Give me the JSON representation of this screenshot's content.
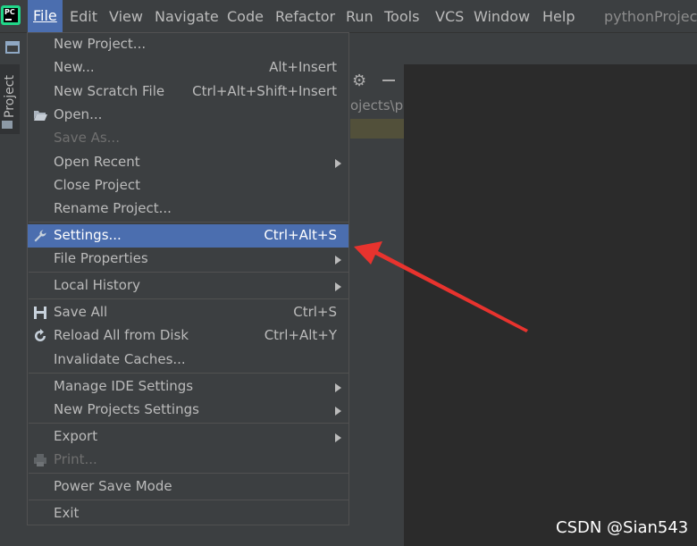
{
  "app": {
    "logo_text": "PC",
    "project_title": "pythonProject"
  },
  "menubar": {
    "items": [
      {
        "label": "File",
        "underline": "F"
      },
      {
        "label": "Edit",
        "underline": "E"
      },
      {
        "label": "View",
        "underline": "V"
      },
      {
        "label": "Navigate",
        "underline": "N"
      },
      {
        "label": "Code",
        "underline": "C"
      },
      {
        "label": "Refactor",
        "underline": "R"
      },
      {
        "label": "Run",
        "underline": "u"
      },
      {
        "label": "Tools",
        "underline": "T"
      },
      {
        "label": "VCS",
        "underline": "S"
      },
      {
        "label": "Window",
        "underline": "W"
      },
      {
        "label": "Help",
        "underline": "H"
      }
    ]
  },
  "left_strip": {
    "project_tab": "Project"
  },
  "project_panel": {
    "path_fragment": "ojects\\p"
  },
  "file_menu": {
    "items": [
      {
        "label": "New Project...",
        "shortcut": "",
        "submenu": false,
        "disabled": false,
        "icon": ""
      },
      {
        "label": "New...",
        "shortcut": "Alt+Insert",
        "submenu": false,
        "disabled": false,
        "icon": ""
      },
      {
        "label": "New Scratch File",
        "shortcut": "Ctrl+Alt+Shift+Insert",
        "submenu": false,
        "disabled": false,
        "icon": ""
      },
      {
        "label": "Open...",
        "shortcut": "",
        "submenu": false,
        "disabled": false,
        "icon": "folder-open-icon"
      },
      {
        "label": "Save As...",
        "shortcut": "",
        "submenu": false,
        "disabled": true,
        "icon": ""
      },
      {
        "label": "Open Recent",
        "shortcut": "",
        "submenu": true,
        "disabled": false,
        "icon": ""
      },
      {
        "label": "Close Project",
        "shortcut": "",
        "submenu": false,
        "disabled": false,
        "icon": ""
      },
      {
        "label": "Rename Project...",
        "shortcut": "",
        "submenu": false,
        "disabled": false,
        "icon": ""
      },
      {
        "label": "Settings...",
        "shortcut": "Ctrl+Alt+S",
        "submenu": false,
        "disabled": false,
        "icon": "wrench-icon",
        "highlighted": true
      },
      {
        "label": "File Properties",
        "shortcut": "",
        "submenu": true,
        "disabled": false,
        "icon": ""
      },
      {
        "label": "Local History",
        "shortcut": "",
        "submenu": true,
        "disabled": false,
        "icon": ""
      },
      {
        "label": "Save All",
        "shortcut": "Ctrl+S",
        "submenu": false,
        "disabled": false,
        "icon": "save-icon"
      },
      {
        "label": "Reload All from Disk",
        "shortcut": "Ctrl+Alt+Y",
        "submenu": false,
        "disabled": false,
        "icon": "reload-icon"
      },
      {
        "label": "Invalidate Caches...",
        "shortcut": "",
        "submenu": false,
        "disabled": false,
        "icon": ""
      },
      {
        "label": "Manage IDE Settings",
        "shortcut": "",
        "submenu": true,
        "disabled": false,
        "icon": ""
      },
      {
        "label": "New Projects Settings",
        "shortcut": "",
        "submenu": true,
        "disabled": false,
        "icon": ""
      },
      {
        "label": "Export",
        "shortcut": "",
        "submenu": true,
        "disabled": false,
        "icon": ""
      },
      {
        "label": "Print...",
        "shortcut": "",
        "submenu": false,
        "disabled": true,
        "icon": "print-icon"
      },
      {
        "label": "Power Save Mode",
        "shortcut": "",
        "submenu": false,
        "disabled": false,
        "icon": ""
      },
      {
        "label": "Exit",
        "shortcut": "",
        "submenu": false,
        "disabled": false,
        "icon": ""
      }
    ]
  },
  "watermark": "CSDN @Sian543",
  "colors": {
    "menu_bg": "#3c3f41",
    "highlight": "#4b6eaf",
    "editor_bg": "#2b2b2b",
    "annotation_arrow": "#e8332e"
  }
}
